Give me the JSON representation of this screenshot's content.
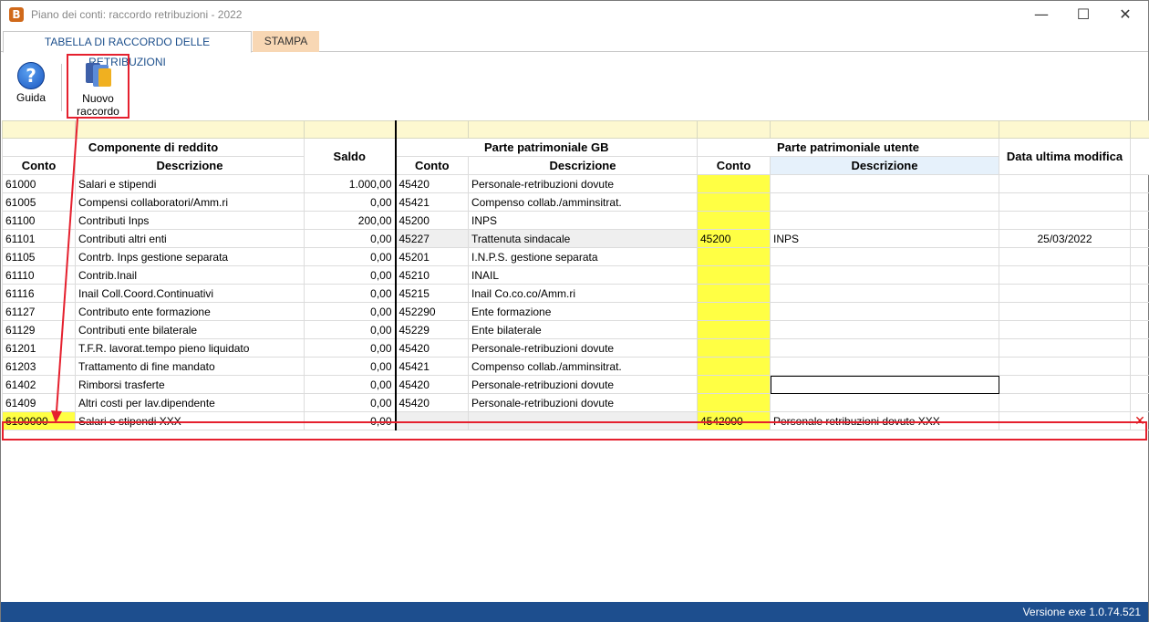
{
  "window": {
    "title": "Piano dei conti: raccordo retribuzioni - 2022",
    "app_icon_letter": "B",
    "minimize": "—",
    "maximize": "☐",
    "close": "✕"
  },
  "tabs": [
    {
      "label": "TABELLA DI RACCORDO DELLE RETRIBUZIONI",
      "active": true
    },
    {
      "label": "STAMPA",
      "active": false
    }
  ],
  "toolbar": {
    "guida_label": "Guida",
    "nuovo_label_1": "Nuovo",
    "nuovo_label_2": "raccordo"
  },
  "table": {
    "group_headers": {
      "componente": "Componente di reddito",
      "saldo": "Saldo",
      "parte_gb": "Parte patrimoniale GB",
      "parte_utente": "Parte patrimoniale utente",
      "data_modifica": "Data ultima modifica"
    },
    "sub_headers": {
      "conto": "Conto",
      "descrizione": "Descrizione",
      "conto_gb": "Conto",
      "descrizione_gb": "Descrizione",
      "conto_utente": "Conto",
      "descrizione_utente": "Descrizione"
    },
    "rows": [
      {
        "conto": "61000",
        "descrizione": "Salari e stipendi",
        "saldo": "1.000,00",
        "conto_gb": "45420",
        "descr_gb": "Personale-retribuzioni dovute",
        "conto_ut": "",
        "descr_ut": "",
        "data": ""
      },
      {
        "conto": "61005",
        "descrizione": "Compensi collaboratori/Amm.ri",
        "saldo": "0,00",
        "conto_gb": "45421",
        "descr_gb": "Compenso collab./amminsitrat.",
        "conto_ut": "",
        "descr_ut": "",
        "data": ""
      },
      {
        "conto": "61100",
        "descrizione": "Contributi Inps",
        "saldo": "200,00",
        "conto_gb": "45200",
        "descr_gb": "INPS",
        "conto_ut": "",
        "descr_ut": "",
        "data": ""
      },
      {
        "conto": "61101",
        "descrizione": "Contributi altri enti",
        "saldo": "0,00",
        "conto_gb": "45227",
        "descr_gb": "Trattenuta sindacale",
        "conto_ut": "45200",
        "descr_ut": "INPS",
        "data": "25/03/2022"
      },
      {
        "conto": "61105",
        "descrizione": "Contrb. Inps gestione separata",
        "saldo": "0,00",
        "conto_gb": "45201",
        "descr_gb": "I.N.P.S. gestione separata",
        "conto_ut": "",
        "descr_ut": "",
        "data": ""
      },
      {
        "conto": "61110",
        "descrizione": "Contrib.Inail",
        "saldo": "0,00",
        "conto_gb": "45210",
        "descr_gb": "INAIL",
        "conto_ut": "",
        "descr_ut": "",
        "data": ""
      },
      {
        "conto": "61116",
        "descrizione": "Inail Coll.Coord.Continuativi",
        "saldo": "0,00",
        "conto_gb": "45215",
        "descr_gb": "Inail Co.co.co/Amm.ri",
        "conto_ut": "",
        "descr_ut": "",
        "data": ""
      },
      {
        "conto": "61127",
        "descrizione": "Contributo ente formazione",
        "saldo": "0,00",
        "conto_gb": "452290",
        "descr_gb": "Ente formazione",
        "conto_ut": "",
        "descr_ut": "",
        "data": ""
      },
      {
        "conto": "61129",
        "descrizione": "Contributi ente bilaterale",
        "saldo": "0,00",
        "conto_gb": "45229",
        "descr_gb": "Ente bilaterale",
        "conto_ut": "",
        "descr_ut": "",
        "data": ""
      },
      {
        "conto": "61201",
        "descrizione": "T.F.R. lavorat.tempo pieno liquidato",
        "saldo": "0,00",
        "conto_gb": "45420",
        "descr_gb": "Personale-retribuzioni dovute",
        "conto_ut": "",
        "descr_ut": "",
        "data": ""
      },
      {
        "conto": "61203",
        "descrizione": "Trattamento di fine mandato",
        "saldo": "0,00",
        "conto_gb": "45421",
        "descr_gb": "Compenso collab./amminsitrat.",
        "conto_ut": "",
        "descr_ut": "",
        "data": ""
      },
      {
        "conto": "61402",
        "descrizione": "Rimborsi trasferte",
        "saldo": "0,00",
        "conto_gb": "45420",
        "descr_gb": "Personale-retribuzioni dovute",
        "conto_ut": "",
        "descr_ut": "",
        "data": ""
      },
      {
        "conto": "61409",
        "descrizione": "Altri costi per lav.dipendente",
        "saldo": "0,00",
        "conto_gb": "45420",
        "descr_gb": "Personale-retribuzioni dovute",
        "conto_ut": "",
        "descr_ut": "",
        "data": ""
      }
    ],
    "new_row": {
      "conto": "6100000",
      "descrizione": "Salari e stipendi XXX",
      "saldo": "0,00",
      "conto_gb": "",
      "descr_gb": "",
      "conto_ut": "4542000",
      "descr_ut": "Personale retribuzioni dovute XXX",
      "data": "",
      "delete_icon": "✕"
    }
  },
  "status": {
    "version": "Versione exe 1.0.74.521"
  },
  "colors": {
    "accent_red": "#e5202e",
    "status_blue": "#1d4e8e",
    "yellow_cell": "#ffff44",
    "tab_other": "#f8d7b4"
  }
}
